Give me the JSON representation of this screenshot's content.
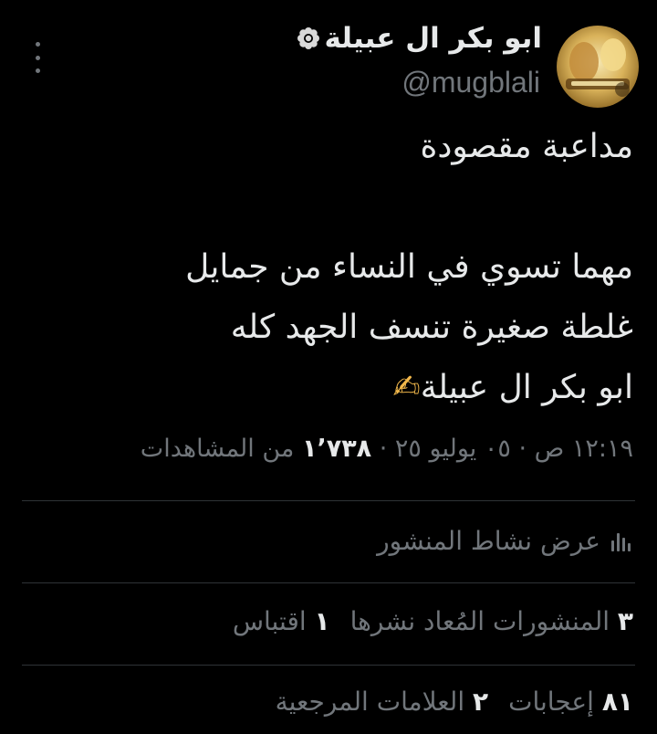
{
  "author": {
    "display_name": "ابو بكر ال عبيلة",
    "handle": "@mugblali",
    "avatar_icon": "avatar-image",
    "name_badge_icon": "flower-icon"
  },
  "post": {
    "line1": "مداعبة مقصودة",
    "line2": "مهما تسوي في النساء من جمايل",
    "line3": "غلطة صغيرة تنسف الجهد كله",
    "line4_emoji": "✍",
    "line4": "ابو بكر ال عبيلة"
  },
  "meta": {
    "time": "١٢:١٩ ص",
    "sep1": " · ",
    "date": "٠٥ يوليو ٢٥",
    "sep2": " · ",
    "views_count": "١٬٧٣٨",
    "views_label": "من المشاهدات"
  },
  "activity": {
    "label": "عرض نشاط المنشور",
    "icon": "bar-chart-icon"
  },
  "stats": {
    "reposts_count": "٣",
    "reposts_label": "المنشورات المُعاد نشرها",
    "quotes_count": "١",
    "quotes_label": "اقتباس",
    "likes_count": "٨١",
    "likes_label": "إعجابات",
    "bookmarks_count": "٢",
    "bookmarks_label": "العلامات المرجعية"
  },
  "colors": {
    "background": "#000000",
    "primary_text": "#e7e9ea",
    "secondary_text": "#71767b",
    "divider": "#2f3336"
  }
}
